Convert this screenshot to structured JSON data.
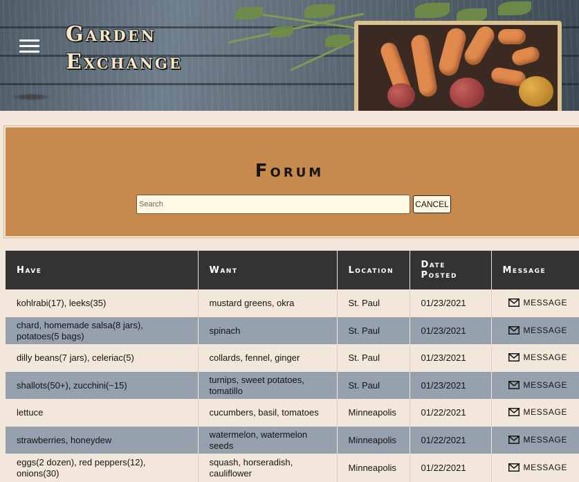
{
  "header": {
    "brand_line1": "Garden",
    "brand_line2": "Exchange"
  },
  "forum": {
    "title": "Forum",
    "search_placeholder": "Search",
    "search_value": "",
    "cancel_label": "CANCEL"
  },
  "table": {
    "columns": {
      "have": "Have",
      "want": "Want",
      "location": "Location",
      "date_line1": "Date",
      "date_line2": "Posted",
      "message": "Message"
    },
    "message_label": "MESSAGE",
    "rows": [
      {
        "have": "kohlrabi(17), leeks(35)",
        "want": "mustard greens, okra",
        "location": "St. Paul",
        "date": "01/23/2021"
      },
      {
        "have": "chard, homemade salsa(8 jars), potatoes(5 bags)",
        "want": "spinach",
        "location": "St. Paul",
        "date": "01/23/2021"
      },
      {
        "have": "dilly beans(7 jars), celeriac(5)",
        "want": "collards, fennel, ginger",
        "location": "St. Paul",
        "date": "01/23/2021"
      },
      {
        "have": "shallots(50+), zucchini(~15)",
        "want": "turnips, sweet potatoes, tomatillo",
        "location": "St. Paul",
        "date": "01/23/2021"
      },
      {
        "have": "lettuce",
        "want": "cucumbers, basil, tomatoes",
        "location": "Minneapolis",
        "date": "01/22/2021"
      },
      {
        "have": "strawberries, honeydew",
        "want": "watermelon, watermelon seeds",
        "location": "Minneapolis",
        "date": "01/22/2021"
      },
      {
        "have": "eggs(2 dozen), red peppers(12), onions(30)",
        "want": "squash, horseradish, cauliflower",
        "location": "Minneapolis",
        "date": "01/22/2021"
      }
    ]
  },
  "colors": {
    "page_background": "#f3e6da",
    "forum_panel": "#c8894d",
    "table_header": "#333333",
    "row_alt": "#95a1ad"
  }
}
